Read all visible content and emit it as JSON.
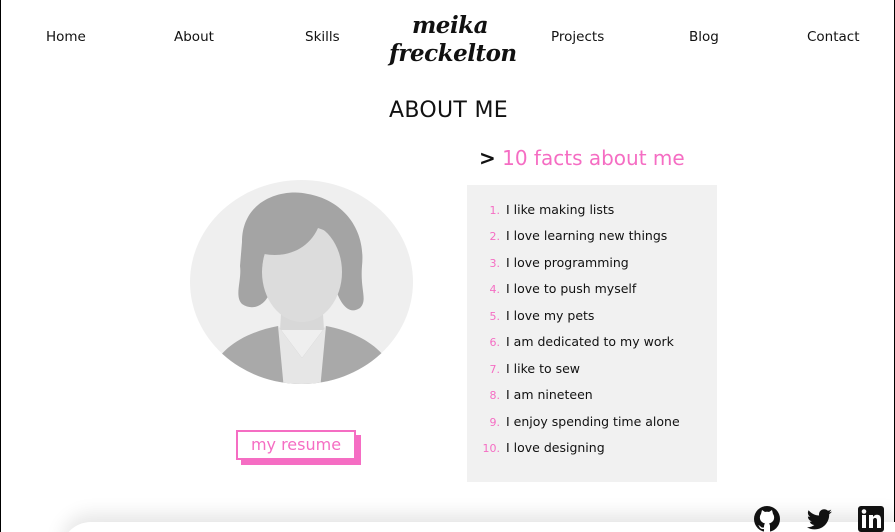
{
  "nav": {
    "home": "Home",
    "about": "About",
    "skills": "Skills",
    "projects": "Projects",
    "blog": "Blog",
    "contact": "Contact"
  },
  "logo": {
    "line1": "meika",
    "line2": "freckelton"
  },
  "page_title": "ABOUT ME",
  "facts": {
    "arrow": ">",
    "title": "10 facts about me",
    "items": [
      {
        "num": "1.",
        "text": "I like making lists"
      },
      {
        "num": "2.",
        "text": "I love learning new things"
      },
      {
        "num": "3.",
        "text": "I love programming"
      },
      {
        "num": "4.",
        "text": "I love to push myself"
      },
      {
        "num": "5.",
        "text": "I love my pets"
      },
      {
        "num": "6.",
        "text": "I am dedicated to my work"
      },
      {
        "num": "7.",
        "text": "I like to sew"
      },
      {
        "num": "8.",
        "text": "I am nineteen"
      },
      {
        "num": "9.",
        "text": "I enjoy spending time alone"
      },
      {
        "num": "10.",
        "text": "I love designing"
      }
    ]
  },
  "resume_label": "my resume",
  "icons": {
    "avatar": "person-placeholder-icon",
    "github": "github-icon",
    "twitter": "twitter-icon",
    "linkedin": "linkedin-icon"
  },
  "colors": {
    "accent": "#f56dc3",
    "panel": "#f1f1f1",
    "avatar_bg": "#efefef",
    "avatar_figure": "#a6a6a6"
  }
}
